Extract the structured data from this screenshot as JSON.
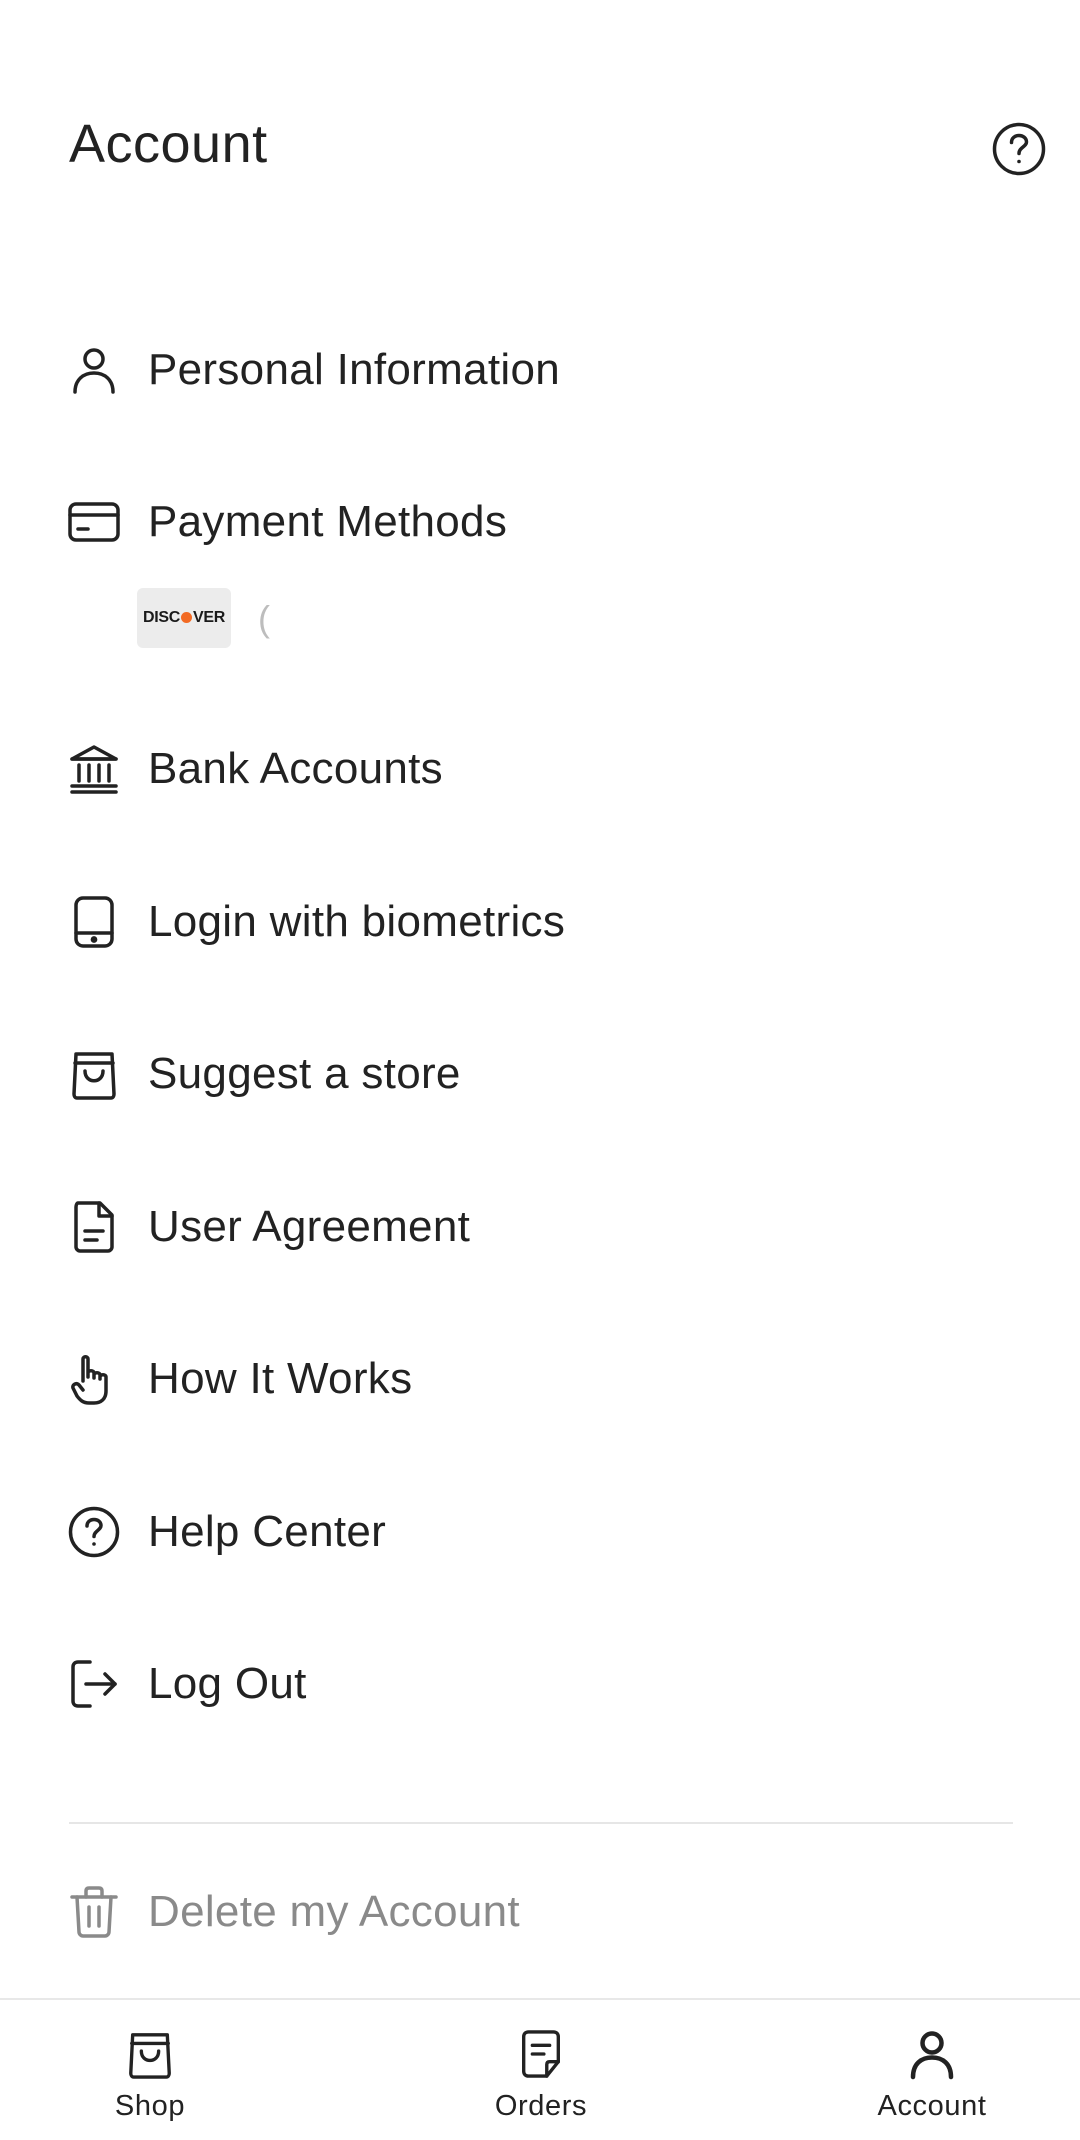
{
  "header": {
    "title": "Account",
    "help_icon": "question-circle-icon"
  },
  "menu": {
    "items": [
      {
        "label": "Personal Information",
        "icon": "person-icon"
      },
      {
        "label": "Payment Methods",
        "icon": "credit-card-icon"
      },
      {
        "label": "Bank Accounts",
        "icon": "bank-icon"
      },
      {
        "label": "Login with biometrics",
        "icon": "phone-icon"
      },
      {
        "label": "Suggest a store",
        "icon": "shopping-bag-icon"
      },
      {
        "label": "User Agreement",
        "icon": "document-icon"
      },
      {
        "label": "How It Works",
        "icon": "pointing-hand-icon"
      },
      {
        "label": "Help Center",
        "icon": "question-circle-icon"
      },
      {
        "label": "Log Out",
        "icon": "logout-icon"
      }
    ],
    "delete": {
      "label": "Delete my Account",
      "icon": "trash-icon"
    }
  },
  "payment": {
    "card_brand_left": "DISC",
    "card_brand_right": "VER",
    "card_number": "(",
    "brand_dot_color": "#f26a23"
  },
  "bottom_nav": {
    "tabs": [
      {
        "label": "Shop",
        "icon": "shopping-bag-icon"
      },
      {
        "label": "Orders",
        "icon": "orders-icon"
      },
      {
        "label": "Account",
        "icon": "person-icon",
        "active": true
      }
    ]
  }
}
